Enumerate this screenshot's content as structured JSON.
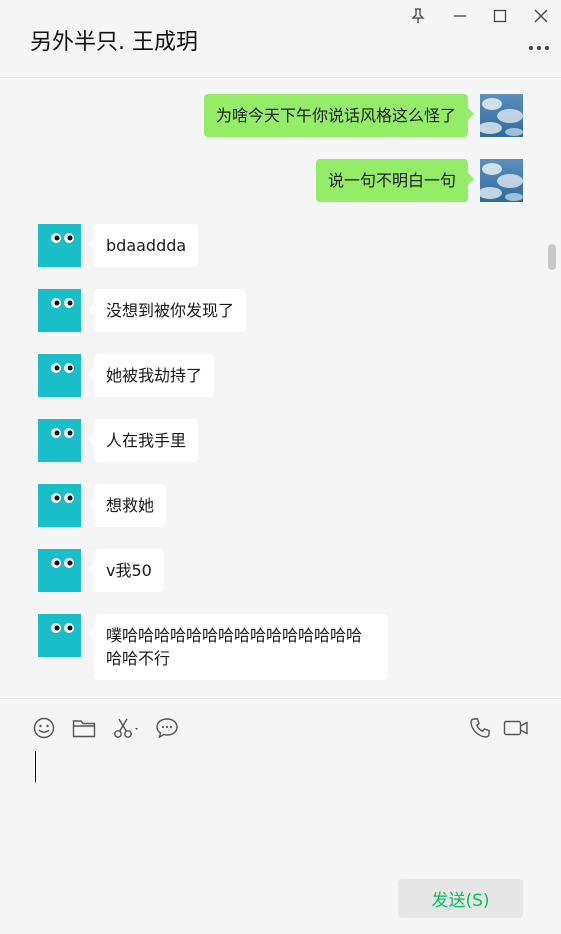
{
  "header": {
    "title": "另外半只. 王成玥",
    "window_controls": [
      "pin-icon",
      "minimize-icon",
      "maximize-icon",
      "close-icon"
    ],
    "more_icon": "more-icon"
  },
  "messages": [
    {
      "sender": "self",
      "text": "为啥今天下午你说话风格这么怪了"
    },
    {
      "sender": "self",
      "text": "说一句不明白一句"
    },
    {
      "sender": "other",
      "text": "bdaaddda"
    },
    {
      "sender": "other",
      "text": "没想到被你发现了"
    },
    {
      "sender": "other",
      "text": "她被我劫持了"
    },
    {
      "sender": "other",
      "text": "人在我手里"
    },
    {
      "sender": "other",
      "text": "想救她"
    },
    {
      "sender": "other",
      "text": "v我50"
    },
    {
      "sender": "other",
      "text": "噗哈哈哈哈哈哈哈哈哈哈哈哈哈哈哈哈哈不行"
    }
  ],
  "toolbar": {
    "left": [
      "emoji-icon",
      "folder-icon",
      "scissors-icon",
      "chat-bubble-icon"
    ],
    "right": [
      "phone-icon",
      "video-icon"
    ]
  },
  "input": {
    "value": ""
  },
  "send_button": {
    "label": "发送(S)"
  },
  "colors": {
    "self_bubble": "#95ec69",
    "other_bubble": "#ffffff",
    "other_avatar": "#19bfc8",
    "send_text": "#07c160",
    "background": "#f5f5f5"
  }
}
